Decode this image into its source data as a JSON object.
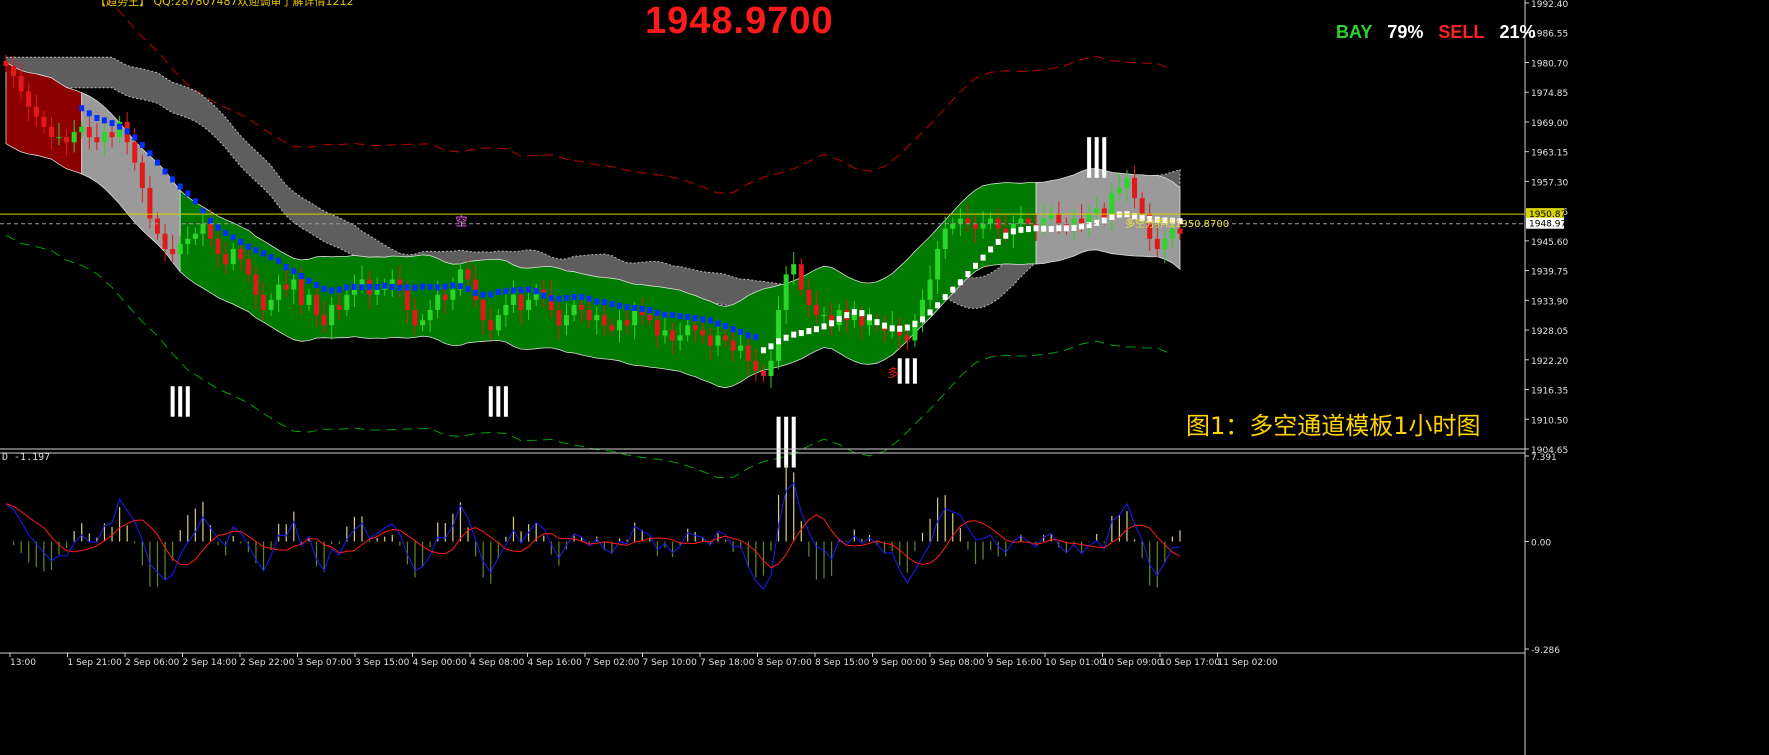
{
  "header": {
    "current_price": "1948.9700",
    "info_text": "【趋势王】 QQ:287807487欢迎调审了解详情1212",
    "bay_label": "BAY",
    "bay_pct": "79%",
    "sell_label": "SELL",
    "sell_pct": "21%",
    "caption": "图1：多空通道模板1小时图"
  },
  "indicator": {
    "label": "D -1.197",
    "axis": [
      "7.391",
      "0.00",
      "-9.286"
    ]
  },
  "levels": {
    "line_label": "多空分界线1950.8700",
    "upper_tag": "1950.87",
    "current_tag": "1948.97",
    "marker_low": "多",
    "marker_top": "空"
  },
  "colors": {
    "background": "#000000",
    "bull_candle": "#29d629",
    "bear_candle": "#e01a1a",
    "bull_channel": "#007a00",
    "bear_channel": "#8c0000",
    "neutral_channel": "#9a9a9a",
    "shadow_band": "#5e5e5e",
    "trend_blue": "#0030ff",
    "trend_white": "#ffffff",
    "outer_red_dash": "#c00000",
    "outer_green_dash": "#00a000",
    "macd_red": "#ff1a1a",
    "macd_blue": "#1a1aff",
    "histogram_pos": "#d8cf7a",
    "histogram_neg": "#5d8a1e",
    "level_yellow": "#d8d000"
  },
  "chart_data": {
    "type": "candlestick",
    "symbol_price": "1948.9700",
    "y_axis": {
      "range": [
        1904.65,
        1992.4
      ],
      "ticks": [
        "1992.40",
        "1986.55",
        "1980.70",
        "1974.85",
        "1969.00",
        "1963.15",
        "1957.30",
        "1951.45",
        "1945.60",
        "1939.75",
        "1933.90",
        "1928.05",
        "1922.20",
        "1916.35",
        "1910.50",
        "1904.65"
      ]
    },
    "x_axis_labels": [
      "13:00",
      "1 Sep 21:00",
      "2 Sep 06:00",
      "2 Sep 14:00",
      "2 Sep 22:00",
      "3 Sep 07:00",
      "3 Sep 15:00",
      "4 Sep 00:00",
      "4 Sep 08:00",
      "4 Sep 16:00",
      "7 Sep 02:00",
      "7 Sep 10:00",
      "7 Sep 18:00",
      "8 Sep 07:00",
      "8 Sep 15:00",
      "9 Sep 00:00",
      "9 Sep 08:00",
      "9 Sep 16:00",
      "10 Sep 01:00",
      "10 Sep 09:00",
      "10 Sep 17:00",
      "11 Sep 02:00"
    ],
    "close_series": [
      1980,
      1978,
      1975,
      1972,
      1970,
      1968,
      1966,
      1966,
      1965,
      1967,
      1968,
      1966,
      1965,
      1967,
      1966,
      1969,
      1965,
      1961,
      1956,
      1950,
      1947,
      1944,
      1943,
      1945,
      1946,
      1947,
      1949,
      1946,
      1943,
      1941,
      1944,
      1942,
      1939,
      1935,
      1932,
      1934,
      1937,
      1936,
      1938,
      1933,
      1935,
      1931,
      1929,
      1933,
      1932,
      1935,
      1937,
      1938,
      1935,
      1936,
      1937,
      1938,
      1936,
      1932,
      1929,
      1930,
      1932,
      1935,
      1934,
      1936,
      1940,
      1938,
      1934,
      1930,
      1928,
      1931,
      1933,
      1935,
      1932,
      1934,
      1936,
      1935,
      1932,
      1929,
      1931,
      1933,
      1932,
      1930,
      1931,
      1929,
      1928,
      1930,
      1929,
      1932,
      1931,
      1930,
      1927,
      1928,
      1926,
      1927,
      1929,
      1928,
      1927,
      1925,
      1927,
      1926,
      1924,
      1925,
      1922,
      1920,
      1919,
      1922,
      1932,
      1939,
      1941,
      1936,
      1933,
      1931,
      1931,
      1929,
      1932,
      1930,
      1931,
      1929,
      1930,
      1929,
      1928,
      1929,
      1927,
      1926,
      1930,
      1934,
      1938,
      1944,
      1948,
      1949,
      1950,
      1949,
      1948,
      1949,
      1950,
      1948,
      1947,
      1949,
      1950,
      1949,
      1948,
      1950,
      1951,
      1949,
      1948,
      1950,
      1949,
      1951,
      1952,
      1950,
      1955,
      1956,
      1958,
      1954,
      1951,
      1946,
      1944,
      1946,
      1948,
      1947
    ],
    "axis_levels": {
      "upper": 1950.87,
      "current": 1948.97
    },
    "indicator_axis": [
      7.391,
      0.0,
      -9.286
    ]
  }
}
